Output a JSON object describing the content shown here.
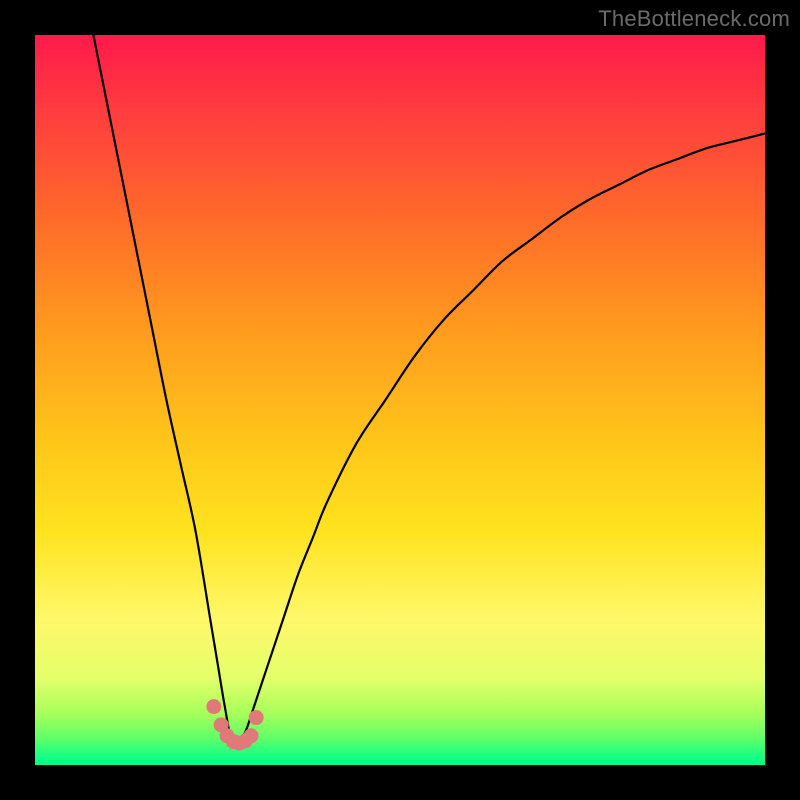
{
  "watermark": "TheBottleneck.com",
  "gradient_stops": [
    {
      "offset": 0.0,
      "color": "#ff1a4b"
    },
    {
      "offset": 0.1,
      "color": "#ff3b3f"
    },
    {
      "offset": 0.25,
      "color": "#ff6a2a"
    },
    {
      "offset": 0.4,
      "color": "#ff9a1e"
    },
    {
      "offset": 0.55,
      "color": "#ffc41a"
    },
    {
      "offset": 0.68,
      "color": "#ffe31f"
    },
    {
      "offset": 0.8,
      "color": "#fff86a"
    },
    {
      "offset": 0.88,
      "color": "#e4ff6a"
    },
    {
      "offset": 0.93,
      "color": "#a6ff5a"
    },
    {
      "offset": 0.965,
      "color": "#5cff6a"
    },
    {
      "offset": 0.985,
      "color": "#1fff82"
    },
    {
      "offset": 1.0,
      "color": "#00ff88"
    }
  ],
  "marker_color": "#e07a7a",
  "chart_data": {
    "type": "line",
    "title": "",
    "xlabel": "",
    "ylabel": "",
    "xlim": [
      0,
      100
    ],
    "ylim": [
      0,
      100
    ],
    "notes": "V-shaped bottleneck curve; minimum near x≈27, y≈3. Axes are unlabeled in the source image, so values are normalized 0–100.",
    "series": [
      {
        "name": "curve",
        "x": [
          8,
          10,
          12,
          14,
          16,
          18,
          20,
          22,
          24,
          25,
          26,
          27,
          28,
          29,
          30,
          31,
          32,
          34,
          36,
          38,
          40,
          44,
          48,
          52,
          56,
          60,
          64,
          68,
          72,
          76,
          80,
          84,
          88,
          92,
          96,
          100
        ],
        "y": [
          100,
          90,
          80,
          70,
          60,
          50,
          41,
          32,
          20,
          14,
          8,
          3,
          3,
          5,
          8,
          11,
          14,
          20,
          26,
          31,
          36,
          44,
          50,
          56,
          61,
          65,
          69,
          72,
          75,
          77.5,
          79.5,
          81.5,
          83,
          84.5,
          85.5,
          86.5
        ]
      }
    ],
    "markers": {
      "name": "minimum-cluster",
      "x": [
        24.5,
        25.5,
        26.3,
        27.2,
        28.0,
        28.8,
        29.6,
        30.3
      ],
      "y": [
        8.0,
        5.5,
        4.0,
        3.2,
        3.0,
        3.3,
        4.0,
        6.5
      ]
    }
  }
}
